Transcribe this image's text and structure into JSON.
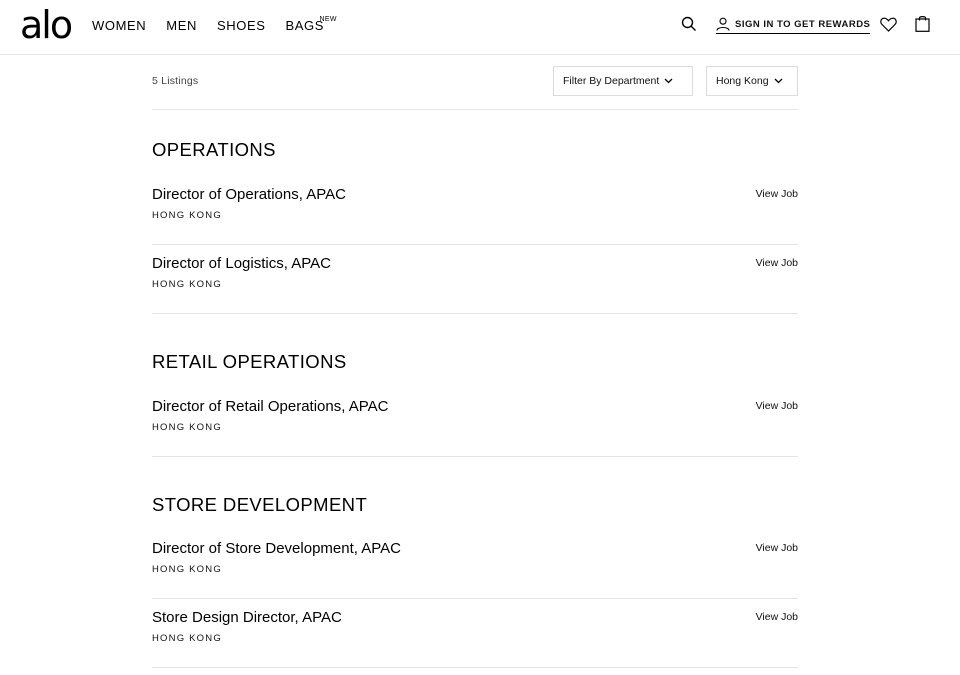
{
  "header": {
    "logo": "alo",
    "nav": [
      {
        "label": "WOMEN"
      },
      {
        "label": "MEN"
      },
      {
        "label": "SHOES"
      },
      {
        "label": "BAGS",
        "badge": "NEW"
      }
    ],
    "signin_label": "SIGN IN TO GET REWARDS",
    "icons": [
      "search-icon",
      "user-icon",
      "heart-icon",
      "bag-icon"
    ]
  },
  "filters": {
    "listing_count": "5 Listings",
    "department_label": "Filter By Department",
    "location_label": "Hong Kong"
  },
  "sections": [
    {
      "title": "OPERATIONS",
      "jobs": [
        {
          "title": "Director of Operations, APAC",
          "location": "HONG KONG",
          "link": "View Job"
        },
        {
          "title": "Director of Logistics, APAC",
          "location": "HONG KONG",
          "link": "View Job"
        }
      ]
    },
    {
      "title": "RETAIL OPERATIONS",
      "jobs": [
        {
          "title": "Director of Retail Operations, APAC",
          "location": "HONG KONG",
          "link": "View Job"
        }
      ]
    },
    {
      "title": "STORE DEVELOPMENT",
      "jobs": [
        {
          "title": "Director of Store Development, APAC",
          "location": "HONG KONG",
          "link": "View Job"
        },
        {
          "title": "Store Design Director, APAC",
          "location": "HONG KONG",
          "link": "View Job"
        }
      ]
    }
  ]
}
